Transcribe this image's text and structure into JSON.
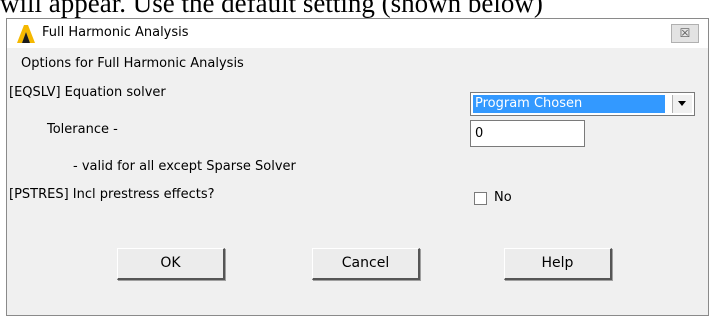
{
  "document": {
    "partial_text": "will appear. Use the default setting  (shown below)"
  },
  "window": {
    "title": "Full Harmonic Analysis",
    "close_glyph": "☒"
  },
  "form": {
    "section_heading": "Options for Full Harmonic Analysis",
    "eqslv_label": "[EQSLV]  Equation solver",
    "eqslv_value": "Program Chosen",
    "tolerance_label": "Tolerance -",
    "tolerance_value": "0",
    "tolerance_note": "- valid for all except Sparse Solver",
    "pstres_label": "[PSTRES] Incl prestress effects?",
    "pstres_checked": false,
    "pstres_state_label": "No"
  },
  "buttons": {
    "ok": "OK",
    "cancel": "Cancel",
    "help": "Help"
  },
  "colors": {
    "logo": "#f5b800",
    "selection": "#3399ff"
  },
  "icons": {
    "logo": "ansys-logo-icon",
    "dropdown": "chevron-down-icon",
    "close": "close-icon"
  }
}
